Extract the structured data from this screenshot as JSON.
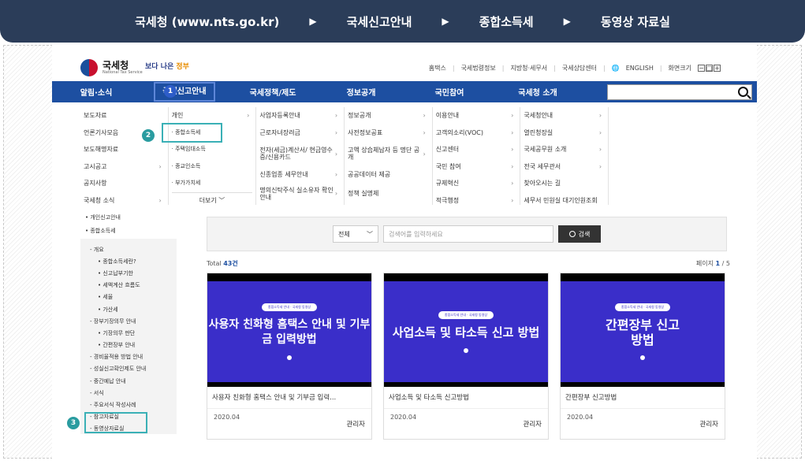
{
  "breadcrumb": {
    "items": [
      "국세청 (www.nts.go.kr)",
      "국세신고안내",
      "종합소득세",
      "동영상 자료실"
    ],
    "arrow": "▶"
  },
  "header": {
    "logo_text": "국세청",
    "logo_sub": "National Tax Service",
    "slogan_a": "보다 나은",
    "slogan_b": "정부",
    "util": [
      "홈택스",
      "국세법령정보",
      "지방청·세무서",
      "국세상담센터",
      "ENGLISH",
      "화면크기"
    ],
    "globe_icon": "🌐",
    "zoom": [
      "−",
      "□",
      "+"
    ]
  },
  "gnb": {
    "items": [
      "알림·소식",
      "국세신고안내",
      "국세정책/제도",
      "정보공개",
      "국민참여",
      "국세청 소개"
    ],
    "active_index": 1
  },
  "mega": {
    "col1": [
      "보도자료",
      "언론기사모음",
      "보도해명자료",
      "고시공고",
      "공지사항",
      "국세청 소식"
    ],
    "col1_chev": [
      "",
      "",
      "",
      "›",
      "",
      "›"
    ],
    "col2": [
      "개인",
      "· 종합소득세",
      "· 주택임대소득",
      "· 종교인소득",
      "· 부가가치세"
    ],
    "col2_more": "더보기 ﹀",
    "col3": [
      "사업자등록안내",
      "근로자녀장려금",
      "전자(세금)계산서/ 현금영수증/신용카드",
      "신종업종 세무안내",
      "명의신탁주식 실소유자 확인안내"
    ],
    "col4": [
      "정보공개",
      "사전정보공표",
      "고액 상습체납자 등 명단 공개",
      "공공데이터 제공",
      "정책 실명제"
    ],
    "col5": [
      "이용안내",
      "고객의소리(VOC)",
      "신고센터",
      "국민 참여",
      "규제혁신",
      "적극행정"
    ],
    "col6": [
      "국세청안내",
      "열린청장실",
      "국세공무원 소개",
      "전국 세무관서",
      "찾아오시는 길",
      "세무서 민원실 대기인원조회"
    ]
  },
  "badges": [
    "1",
    "2",
    "3"
  ],
  "lnb": {
    "top": [
      "• 개인신고안내",
      "• 종합소득세"
    ],
    "sub": [
      {
        "t": "- 개요",
        "lvl": 2
      },
      {
        "t": "• 종합소득세란?",
        "lvl": 3
      },
      {
        "t": "• 신고납부기한",
        "lvl": 3
      },
      {
        "t": "• 세액계산 흐름도",
        "lvl": 3
      },
      {
        "t": "• 세율",
        "lvl": 3
      },
      {
        "t": "• 가산세",
        "lvl": 3
      },
      {
        "t": "- 장부기장의무 안내",
        "lvl": 2
      },
      {
        "t": "• 기장의무 판단",
        "lvl": 3
      },
      {
        "t": "• 간편장부 안내",
        "lvl": 3
      },
      {
        "t": "- 경비율적용 방법 안내",
        "lvl": 2
      },
      {
        "t": "- 성실신고확인제도 안내",
        "lvl": 2
      },
      {
        "t": "- 중간예납 안내",
        "lvl": 2
      },
      {
        "t": "- 서식",
        "lvl": 2
      },
      {
        "t": "- 주요서식 작성사례",
        "lvl": 2
      },
      {
        "t": "- 참고자료실",
        "lvl": 2
      },
      {
        "t": "- 동영상자료실",
        "lvl": 2
      }
    ]
  },
  "search": {
    "select": "전체",
    "placeholder": "검색어를 입력하세요",
    "button": "검색"
  },
  "list_meta": {
    "total_label": "Total",
    "total_num": "43건",
    "page_label": "페이지",
    "page_cur": "1",
    "page_total": "/ 5"
  },
  "cards": [
    {
      "tag": "종합소득세 안내 · 국세청 동영상",
      "title": "사용자 친화형 홈택스 안내 및 기부금 입력방법",
      "caption": "사용자 친화형 홈택스 안내 및 기부금 입력...",
      "date": "2020.04",
      "author": "관리자"
    },
    {
      "tag": "종합소득세 안내 · 국세청 동영상",
      "title": "사업소득 및 타소득 신고 방법",
      "caption": "사업소득 및 타소득 신고방법",
      "date": "2020.04",
      "author": "관리자"
    },
    {
      "tag": "종합소득세 안내 · 국세청 동영상",
      "title": "간편장부 신고방법",
      "caption": "간편장부 신고방법",
      "date": "2020.04",
      "author": "관리자"
    }
  ],
  "colors": {
    "nav": "#1d4fa1",
    "topbar": "#2b3d59",
    "highlight": "#3ab0b6",
    "thumb": "#3a2ec9"
  }
}
